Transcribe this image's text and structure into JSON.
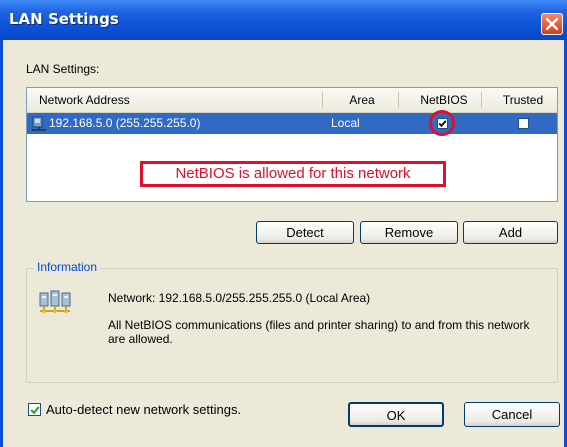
{
  "window": {
    "title": "LAN Settings"
  },
  "lan_label": "LAN Settings:",
  "list": {
    "columns": [
      "Network Address",
      "Area",
      "NetBIOS",
      "Trusted"
    ],
    "rows": [
      {
        "address": "192.168.5.0 (255.255.255.0)",
        "area": "Local",
        "netbios": true,
        "trusted": false
      }
    ],
    "callout": "NetBIOS is allowed for this network"
  },
  "buttons": {
    "detect": "Detect",
    "remove": "Remove",
    "add": "Add",
    "ok": "OK",
    "cancel": "Cancel"
  },
  "information": {
    "legend": "Information",
    "network": "Network: 192.168.5.0/255.255.255.0 (Local Area)",
    "description": "All NetBIOS communications (files and printer sharing) to and from this network are allowed.",
    "icon": "network-computers-icon"
  },
  "autodetect": {
    "label": "Auto-detect new network settings.",
    "checked": true
  },
  "colors": {
    "title_bar": "#0a4fd4",
    "selection": "#316ac5",
    "highlight": "#e0102b",
    "legend": "#0046d5"
  }
}
